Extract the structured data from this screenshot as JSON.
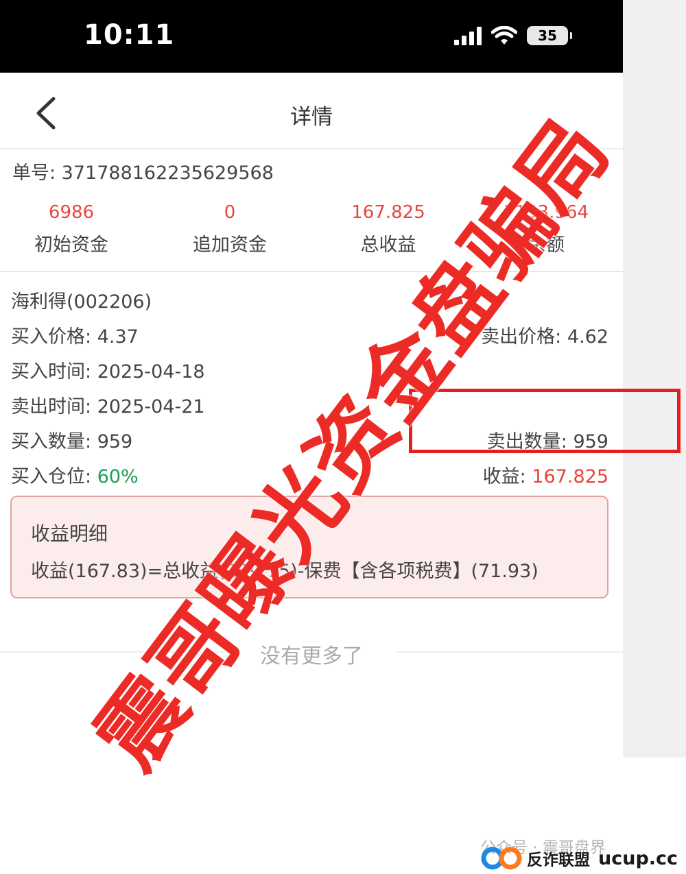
{
  "status_bar": {
    "time": "10:11",
    "battery": "35"
  },
  "nav": {
    "title": "详情"
  },
  "order": {
    "label": "单号: 371788162235629568"
  },
  "stats": [
    {
      "value": "6986",
      "label": "初始资金"
    },
    {
      "value": "0",
      "label": "追加资金"
    },
    {
      "value": "167.825",
      "label": "总收益"
    },
    {
      "value": "7153.964",
      "label": "余额"
    }
  ],
  "stock": {
    "name": "海利得(002206)",
    "buy_price_label": "买入价格: ",
    "buy_price": "4.37",
    "sell_price_label": "卖出价格: ",
    "sell_price": "4.62",
    "buy_time_label": "买入时间: ",
    "buy_time": "2025-04-18",
    "sell_time_label": "卖出时间: ",
    "sell_time": "2025-04-21",
    "buy_qty_label": "买入数量: ",
    "buy_qty": "959",
    "sell_qty_label": "卖出数量: ",
    "sell_qty": "959",
    "position_label": "买入仓位: ",
    "position": "60%",
    "profit_label": "收益: ",
    "profit": "167.825"
  },
  "profit_detail": {
    "title": "收益明细",
    "formula": "收益(167.83)=总收益(239.75)-保费【含各项税费】(71.93)"
  },
  "list_end": "没有更多了",
  "watermark": "震哥曝光资金盘骗局",
  "footer": {
    "wechat": "公众号 · 震哥盘界",
    "org": "反诈联盟",
    "domain": "ucup.cc"
  },
  "colors": {
    "accent_red": "#e8453c",
    "green": "#1f9d55",
    "highlight_box": "#e61e1e"
  }
}
